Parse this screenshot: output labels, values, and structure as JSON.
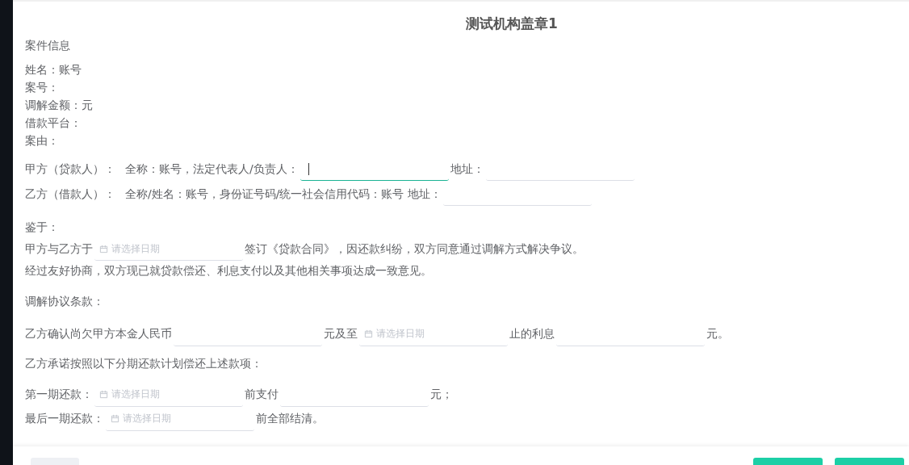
{
  "dialog": {
    "title": "测试机构盖章1",
    "sections": [
      {
        "lines": [
          [
            {
              "kind": "heading",
              "text": "案件信息"
            }
          ],
          [
            {
              "kind": "text",
              "text": "姓名：账号"
            }
          ],
          [
            {
              "kind": "text",
              "text": "案号："
            }
          ],
          [
            {
              "kind": "text",
              "text": "调解金额：元"
            }
          ],
          [
            {
              "kind": "text",
              "text": "借款平台："
            }
          ],
          [
            {
              "kind": "text",
              "text": "案由："
            }
          ]
        ]
      },
      {
        "lines": [
          [
            {
              "kind": "text",
              "text": "甲方（贷款人）："
            },
            {
              "kind": "text",
              "text": "全称：账号，法定代表人/负责人："
            },
            {
              "kind": "input",
              "focused": true
            },
            {
              "kind": "text",
              "text": "地址："
            },
            {
              "kind": "input",
              "focused": false
            }
          ],
          [
            {
              "kind": "text",
              "text": "乙方（借款人）："
            },
            {
              "kind": "text",
              "text": "全称/姓名：账号，"
            },
            {
              "kind": "text",
              "text": "身份证号码/统一社会信用代码：账号 地址："
            },
            {
              "kind": "input",
              "focused": false
            }
          ]
        ]
      },
      {
        "lines": [
          [
            {
              "kind": "text",
              "text": "鉴于："
            }
          ],
          [
            {
              "kind": "text",
              "text": "甲方与乙方于"
            },
            {
              "kind": "date",
              "placeholder": "请选择日期"
            },
            {
              "kind": "text",
              "text": "签订《贷款合同》，因还款纠纷，双方同意通过调解方式解决争议。"
            }
          ],
          [
            {
              "kind": "text",
              "text": "经过友好协商，双方现已就贷款偿还、利息支付以及其他相关事项达成一致意见。"
            }
          ]
        ]
      },
      {
        "lines": [
          [
            {
              "kind": "text",
              "text": "调解协议条款："
            }
          ]
        ]
      },
      {
        "lines": [
          [
            {
              "kind": "text",
              "text": "乙方确认尚欠甲方本金人民币"
            },
            {
              "kind": "input",
              "focused": false
            },
            {
              "kind": "text",
              "text": "元及至"
            },
            {
              "kind": "date",
              "placeholder": "请选择日期"
            },
            {
              "kind": "text",
              "text": "止的利息"
            },
            {
              "kind": "input",
              "focused": false
            },
            {
              "kind": "text",
              "text": "元。"
            }
          ]
        ]
      },
      {
        "lines": [
          [
            {
              "kind": "text",
              "text": "乙方承诺按照以下分期还款计划偿还上述款项："
            }
          ]
        ]
      },
      {
        "lines": [
          [
            {
              "kind": "text",
              "text": "第一期还款："
            },
            {
              "kind": "date",
              "placeholder": "请选择日期"
            },
            {
              "kind": "text",
              "text": "前支付"
            },
            {
              "kind": "input",
              "focused": false
            },
            {
              "kind": "text",
              "text": "元；"
            }
          ],
          [
            {
              "kind": "text",
              "text": "最后一期还款："
            },
            {
              "kind": "date",
              "placeholder": "请选择日期"
            },
            {
              "kind": "text",
              "text": "前全部结清。"
            }
          ]
        ]
      }
    ]
  }
}
